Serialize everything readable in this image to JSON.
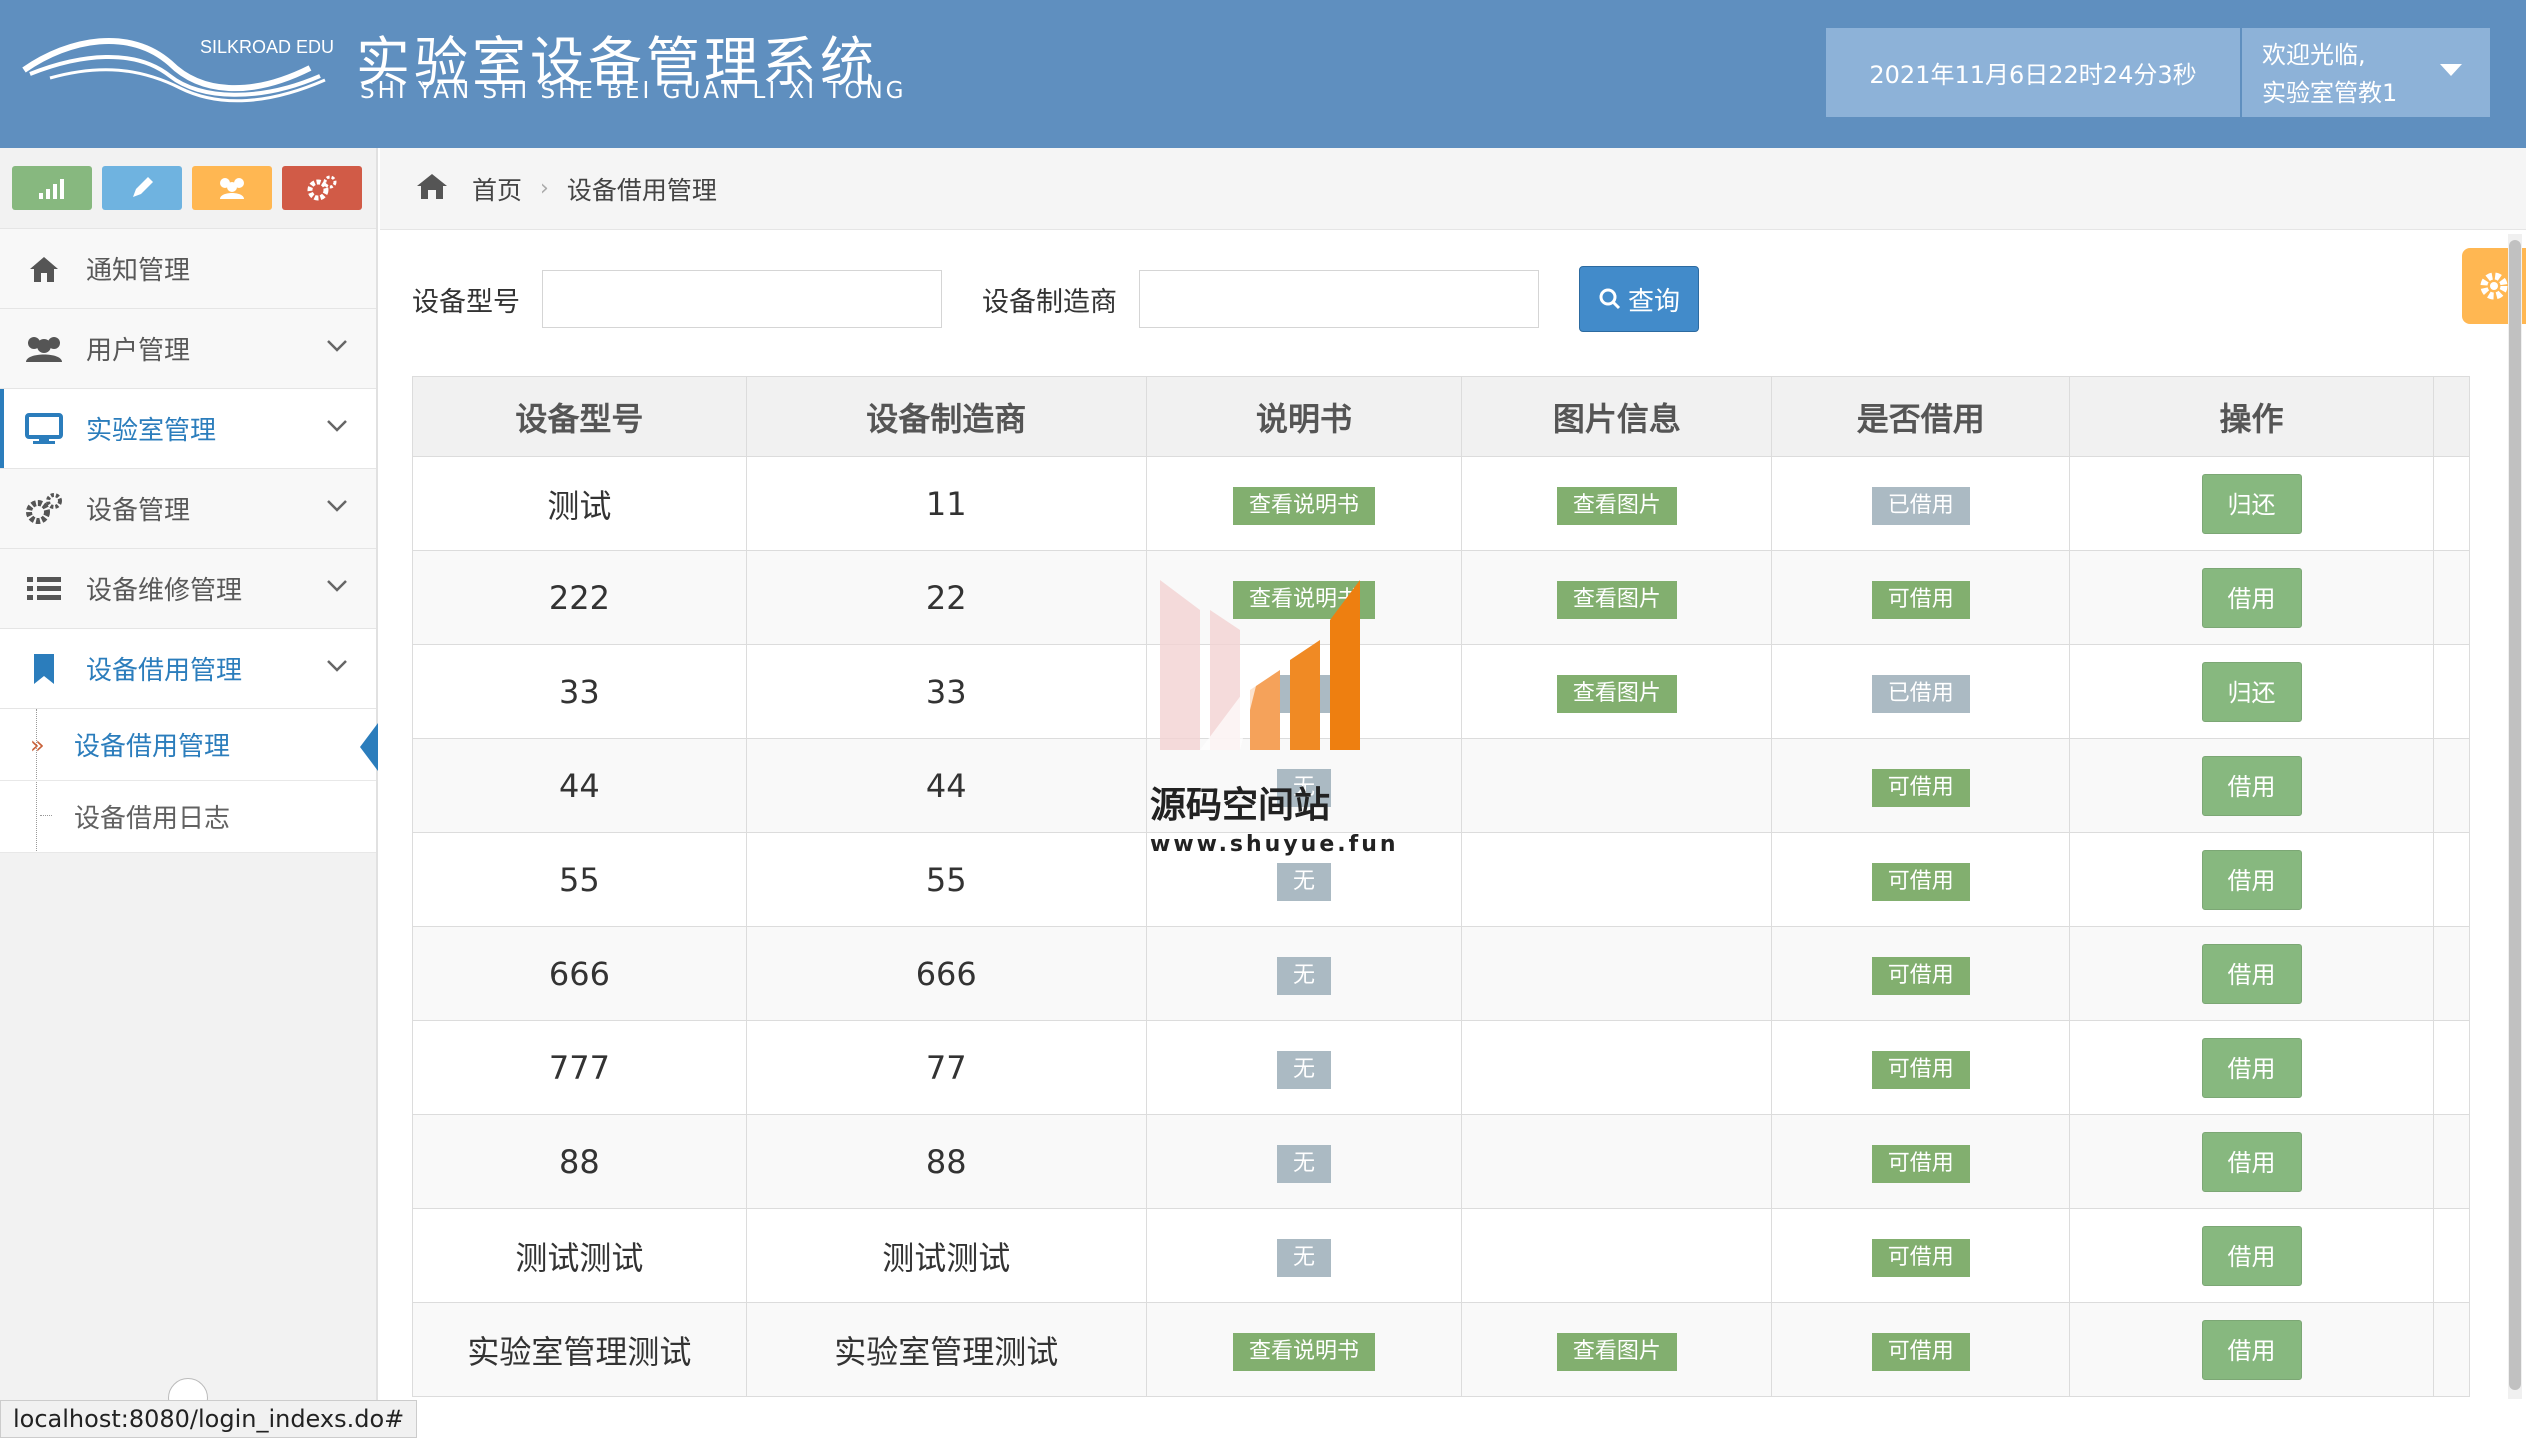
{
  "header": {
    "logo_text": "SILKROAD EDU",
    "title": "实验室设备管理系统",
    "subtitle": "SHI YAN SHI SHE BEI GUAN LI XI TONG",
    "datetime": "2021年11月6日22时24分3秒",
    "welcome": "欢迎光临,",
    "user": "实验室管教1"
  },
  "sidebar": {
    "menu": [
      {
        "label": "通知管理",
        "icon": "home-icon"
      },
      {
        "label": "用户管理",
        "icon": "users-icon"
      },
      {
        "label": "实验室管理",
        "icon": "desktop-icon"
      },
      {
        "label": "设备管理",
        "icon": "cogs-icon"
      },
      {
        "label": "设备维修管理",
        "icon": "list-icon"
      },
      {
        "label": "设备借用管理",
        "icon": "bookmark-icon"
      }
    ],
    "submenu": [
      {
        "label": "设备借用管理"
      },
      {
        "label": "设备借用日志"
      }
    ]
  },
  "status_url": "localhost:8080/login_indexs.do#",
  "breadcrumb": {
    "home": "首页",
    "current": "设备借用管理"
  },
  "search": {
    "model_label": "设备型号",
    "maker_label": "设备制造商",
    "button": "查询"
  },
  "table": {
    "headers": [
      "设备型号",
      "设备制造商",
      "说明书",
      "图片信息",
      "是否借用",
      "操作"
    ],
    "rows": [
      {
        "model": "测试",
        "maker": "11",
        "manual": "查看说明书",
        "image": "查看图片",
        "status": "已借用",
        "action": "归还"
      },
      {
        "model": "222",
        "maker": "22",
        "manual": "查看说明书",
        "image": "查看图片",
        "status": "可借用",
        "action": "借用"
      },
      {
        "model": "33",
        "maker": "33",
        "manual": "无",
        "image": "查看图片",
        "status": "已借用",
        "action": "归还"
      },
      {
        "model": "44",
        "maker": "44",
        "manual": "无",
        "image": "",
        "status": "可借用",
        "action": "借用"
      },
      {
        "model": "55",
        "maker": "55",
        "manual": "无",
        "image": "",
        "status": "可借用",
        "action": "借用"
      },
      {
        "model": "666",
        "maker": "666",
        "manual": "无",
        "image": "",
        "status": "可借用",
        "action": "借用"
      },
      {
        "model": "777",
        "maker": "77",
        "manual": "无",
        "image": "",
        "status": "可借用",
        "action": "借用"
      },
      {
        "model": "88",
        "maker": "88",
        "manual": "无",
        "image": "",
        "status": "可借用",
        "action": "借用"
      },
      {
        "model": "测试测试",
        "maker": "测试测试",
        "manual": "无",
        "image": "",
        "status": "可借用",
        "action": "借用"
      },
      {
        "model": "实验室管理测试",
        "maker": "实验室管理测试",
        "manual": "查看说明书",
        "image": "查看图片",
        "status": "可借用",
        "action": "借用"
      }
    ]
  },
  "watermark": {
    "title": "源码空间站",
    "url": "www.shuyue.fun"
  },
  "colors": {
    "header_bg": "#5f8fbf",
    "accent_blue": "#2b7dbc",
    "label_green": "#82af6f",
    "label_grey": "#abbac3",
    "button_green": "#87b87f"
  }
}
